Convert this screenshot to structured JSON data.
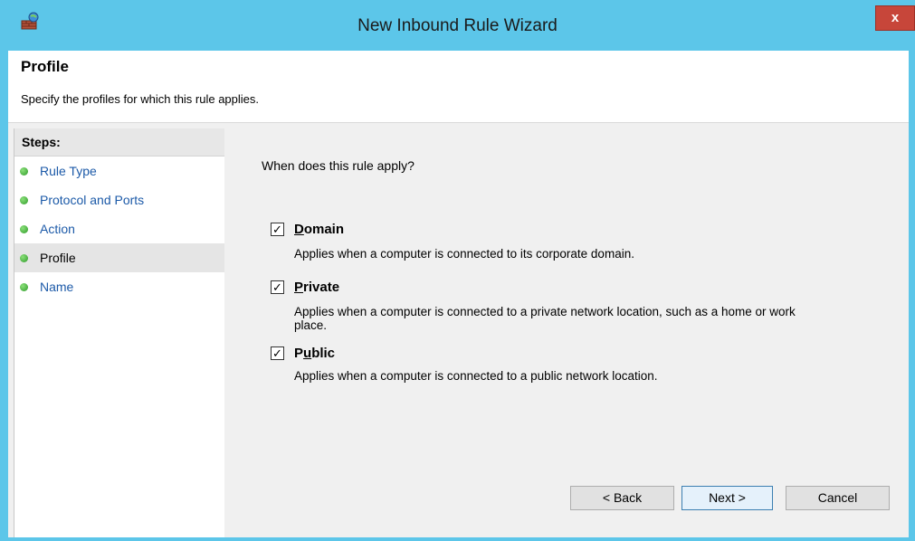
{
  "window": {
    "title": "New Inbound Rule Wizard",
    "close_label": "x"
  },
  "header": {
    "title": "Profile",
    "subtitle": "Specify the profiles for which this rule applies."
  },
  "steps": {
    "header": "Steps:",
    "items": [
      {
        "label": "Rule Type"
      },
      {
        "label": "Protocol and Ports"
      },
      {
        "label": "Action"
      },
      {
        "label": "Profile",
        "current": true
      },
      {
        "label": "Name"
      }
    ]
  },
  "content": {
    "question": "When does this rule apply?",
    "options": [
      {
        "label_first": "D",
        "label_rest": "omain",
        "checked": true,
        "description": "Applies when a computer is connected to its corporate domain."
      },
      {
        "label_first": "P",
        "label_rest": "rivate",
        "checked": true,
        "description": "Applies when a computer is connected to a private network location, such as a home or work place."
      },
      {
        "label_first": "P",
        "label_rest": "ublic",
        "checked": true,
        "underline_second": true,
        "description": "Applies when a computer is connected to a public network location."
      }
    ]
  },
  "buttons": {
    "back": "< Back",
    "next": "Next >",
    "cancel": "Cancel"
  },
  "colors": {
    "titlebar": "#5cc6e9",
    "close": "#c7463a",
    "step_link": "#1c5aa8"
  }
}
